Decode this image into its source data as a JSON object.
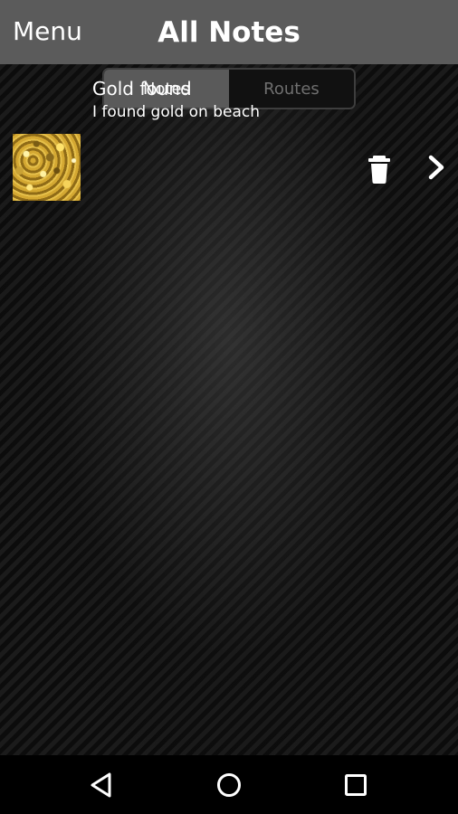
{
  "header": {
    "menu_label": "Menu",
    "title": "All Notes",
    "background": "#5b5b5b"
  },
  "segmented": {
    "tabs": [
      {
        "label": "Notes",
        "selected": true
      },
      {
        "label": "Routes",
        "selected": false
      }
    ]
  },
  "notes": [
    {
      "title": "Gold found",
      "description": "I found gold on beach",
      "thumbnail": "gold-nuggets-image",
      "actions": [
        "trash-icon",
        "chevron-right-icon"
      ]
    }
  ],
  "navbar": {
    "buttons": [
      "back-triangle-icon",
      "home-circle-icon",
      "recents-square-icon"
    ]
  }
}
